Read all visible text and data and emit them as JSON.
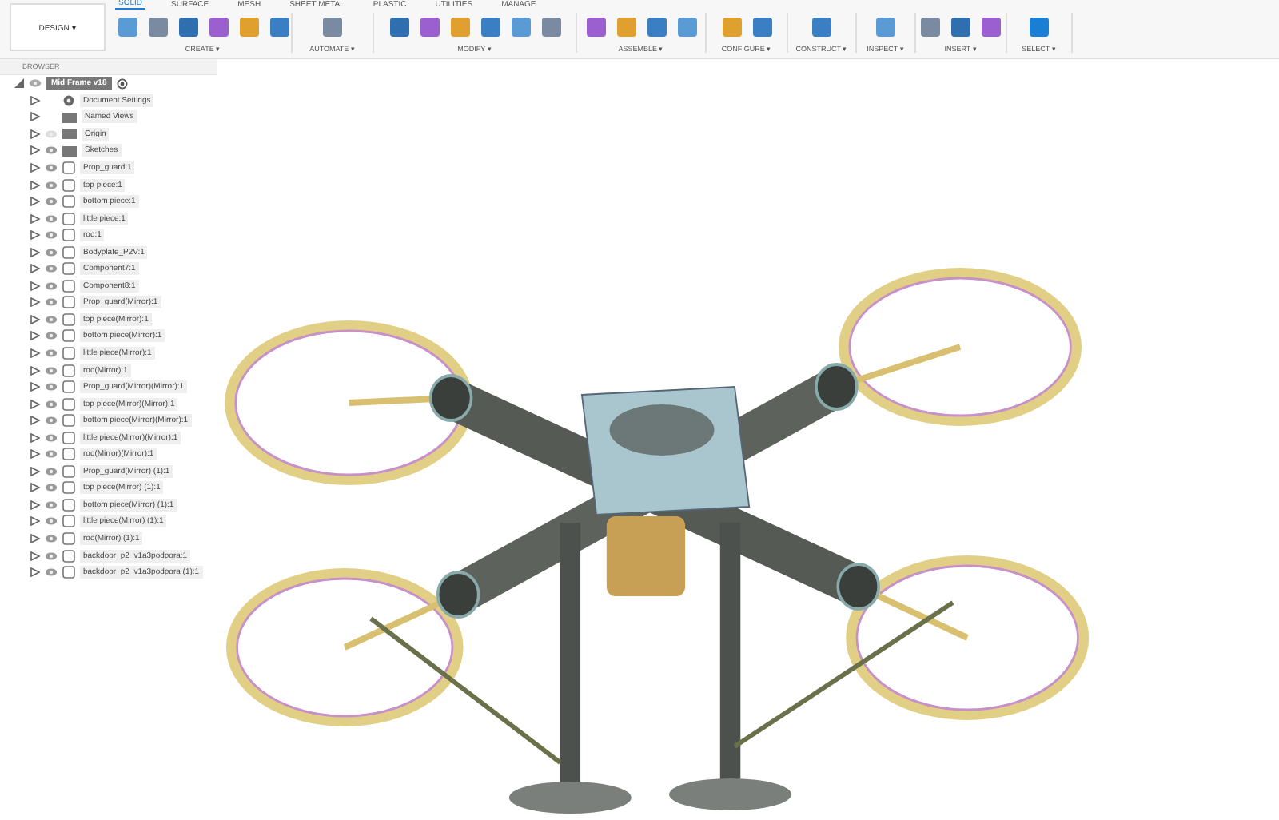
{
  "workspace": {
    "label": "DESIGN ▾"
  },
  "tabs": [
    {
      "label": "SOLID",
      "selected": true
    },
    {
      "label": "SURFACE",
      "selected": false
    },
    {
      "label": "MESH",
      "selected": false
    },
    {
      "label": "SHEET METAL",
      "selected": false
    },
    {
      "label": "PLASTIC",
      "selected": false
    },
    {
      "label": "UTILITIES",
      "selected": false
    },
    {
      "label": "MANAGE",
      "selected": false
    }
  ],
  "groups": [
    {
      "label": "CREATE ▾"
    },
    {
      "label": "AUTOMATE ▾"
    },
    {
      "label": "MODIFY ▾"
    },
    {
      "label": "ASSEMBLE ▾"
    },
    {
      "label": "CONFIGURE ▾"
    },
    {
      "label": "CONSTRUCT ▾"
    },
    {
      "label": "INSPECT ▾"
    },
    {
      "label": "INSERT ▾"
    },
    {
      "label": "SELECT ▾"
    }
  ],
  "browser": {
    "title": "BROWSER",
    "root": {
      "label": "Mid Frame v18",
      "expanded": true,
      "children": [
        {
          "label": "Document Settings",
          "kind": "settings"
        },
        {
          "label": "Named Views",
          "kind": "folder"
        },
        {
          "label": "Origin",
          "kind": "folder",
          "visible": false
        },
        {
          "label": "Sketches",
          "kind": "folder",
          "visible": true
        },
        {
          "label": "Prop_guard:1",
          "kind": "component",
          "visible": true
        },
        {
          "label": "top piece:1",
          "kind": "component",
          "visible": true
        },
        {
          "label": "bottom piece:1",
          "kind": "component",
          "visible": true
        },
        {
          "label": "little piece:1",
          "kind": "component",
          "visible": true
        },
        {
          "label": "rod:1",
          "kind": "component",
          "visible": true
        },
        {
          "label": "Bodyplate_P2V:1",
          "kind": "component",
          "visible": true
        },
        {
          "label": "Component7:1",
          "kind": "component",
          "visible": true
        },
        {
          "label": "Component8:1",
          "kind": "component",
          "visible": true
        },
        {
          "label": "Prop_guard(Mirror):1",
          "kind": "component",
          "visible": true
        },
        {
          "label": "top piece(Mirror):1",
          "kind": "component",
          "visible": true
        },
        {
          "label": "bottom piece(Mirror):1",
          "kind": "component",
          "visible": true
        },
        {
          "label": "little piece(Mirror):1",
          "kind": "component",
          "visible": true
        },
        {
          "label": "rod(Mirror):1",
          "kind": "component",
          "visible": true
        },
        {
          "label": "Prop_guard(Mirror)(Mirror):1",
          "kind": "component",
          "visible": true
        },
        {
          "label": "top piece(Mirror)(Mirror):1",
          "kind": "component",
          "visible": true
        },
        {
          "label": "bottom piece(Mirror)(Mirror):1",
          "kind": "component",
          "visible": true
        },
        {
          "label": "little piece(Mirror)(Mirror):1",
          "kind": "component",
          "visible": true
        },
        {
          "label": "rod(Mirror)(Mirror):1",
          "kind": "component",
          "visible": true
        },
        {
          "label": "Prop_guard(Mirror) (1):1",
          "kind": "component",
          "visible": true
        },
        {
          "label": "top piece(Mirror) (1):1",
          "kind": "component",
          "visible": true
        },
        {
          "label": "bottom piece(Mirror) (1):1",
          "kind": "component",
          "visible": true
        },
        {
          "label": "little piece(Mirror) (1):1",
          "kind": "component",
          "visible": true
        },
        {
          "label": "rod(Mirror) (1):1",
          "kind": "component",
          "visible": true
        },
        {
          "label": "backdoor_p2_v1a3podpora:1",
          "kind": "component",
          "visible": true
        },
        {
          "label": "backdoor_p2_v1a3podpora (1):1",
          "kind": "component",
          "visible": true
        }
      ]
    }
  }
}
